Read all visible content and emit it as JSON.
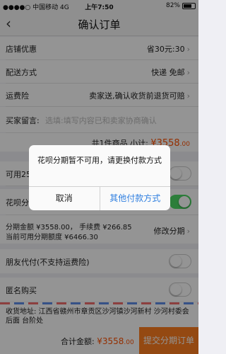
{
  "status": {
    "carrier": "中国移动",
    "network": "4G",
    "time": "上午7:50",
    "battery": "82%",
    "battery_level": 0.82
  },
  "nav": {
    "title": "确认订单",
    "back_icon": "chevron-left-icon"
  },
  "rows": {
    "shop_discount": {
      "label": "店铺优惠",
      "value": "省30元:30"
    },
    "delivery": {
      "label": "配送方式",
      "value": "快递 免邮"
    },
    "insurance": {
      "label": "运费险",
      "value": "卖家送,确认收货前退货可赔"
    },
    "message": {
      "label": "买家留言:",
      "placeholder": "选填:填写内容已和卖家协商确认"
    },
    "summary": {
      "count": "共1件商品",
      "subtotal_label": "小计:",
      "subtotal": "¥3558",
      "subtotal_decimal": ".00"
    },
    "usable": {
      "label": "可用25"
    },
    "huabei": {
      "label": "花呗分"
    },
    "installment": {
      "line1": "分期金额 ¥3558.00， 手续费 ¥266.85",
      "line2": "当前可用分期额度 ¥6466.30",
      "action": "修改分期"
    },
    "friend_pay": {
      "label": "朋友代付(不支持运费险)"
    },
    "anonymous": {
      "label": "匿名购买"
    },
    "address": {
      "text": "收货地址: 江西省赣州市章贡区沙河镇沙河新村 沙河村委会后面 台阶处"
    }
  },
  "bottom": {
    "total_label": "合计金额:",
    "total": "¥3558",
    "total_decimal": ".00",
    "submit": "提交分期订单"
  },
  "dialog": {
    "message": "花呗分期暂不可用，请更换付款方式",
    "cancel": "取消",
    "other": "其他付款方式"
  },
  "colors": {
    "accent": "#ff7e1f",
    "price": "#ff5000",
    "link": "#2f7fe0",
    "toggle_on": "#4cd964"
  }
}
